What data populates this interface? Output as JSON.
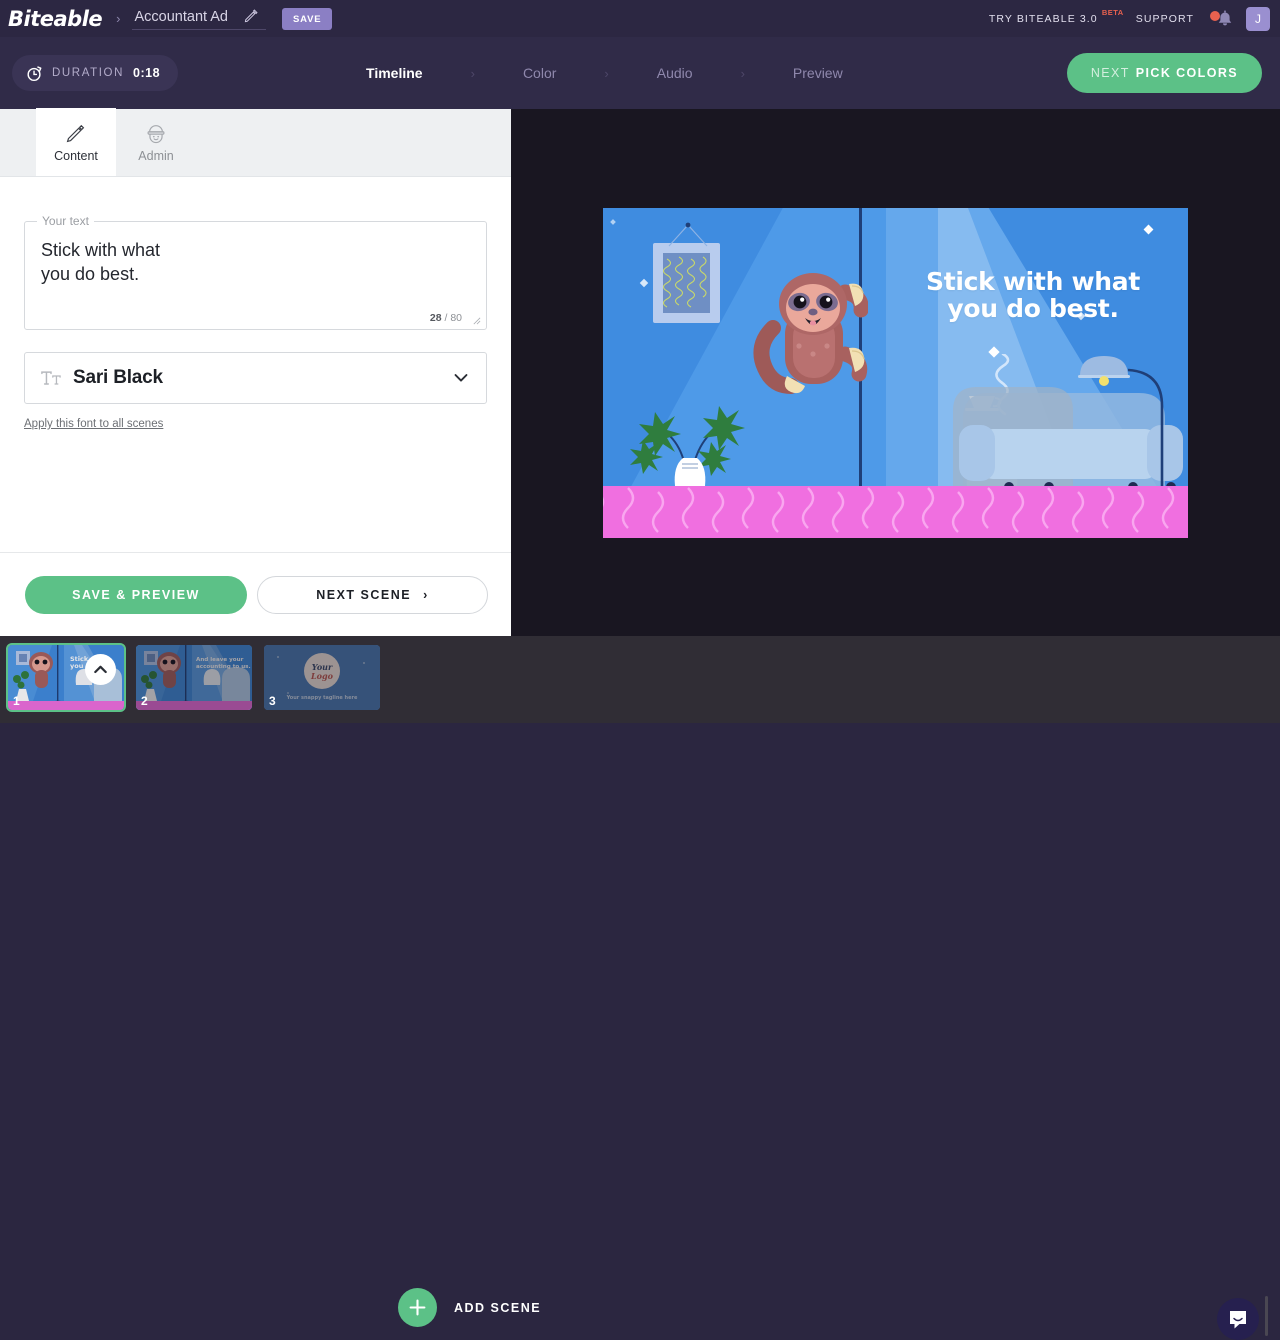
{
  "topbar": {
    "brand": "Biteable",
    "separator": "›",
    "project_name": "Accountant Ad",
    "save_label": "SAVE",
    "try_label": "TRY BITEABLE 3.0",
    "beta_label": "BETA",
    "support_label": "SUPPORT",
    "avatar_initial": "J",
    "icons": {
      "pencil": "pencil-icon",
      "bell": "bell-icon",
      "notification_dot": "notification-dot"
    },
    "colors": {
      "bar_bg": "#2c2742",
      "save_btn": "#8b7fc4",
      "beta_accent": "#e8614f",
      "avatar_bg": "#9a8fd0"
    }
  },
  "stepbar": {
    "duration_label": "DURATION",
    "duration_value": "0:18",
    "steps": [
      {
        "label": "Timeline",
        "active": true
      },
      {
        "label": "Color",
        "active": false
      },
      {
        "label": "Audio",
        "active": false
      },
      {
        "label": "Preview",
        "active": false
      }
    ],
    "step_arrow": "›",
    "next_prefix": "NEXT",
    "next_main": "PICK COLORS",
    "colors": {
      "bar_bg": "#302b48",
      "next_btn": "#5cc187",
      "pill_bg": "#3a3455"
    }
  },
  "panel": {
    "tabs": [
      {
        "label": "Content",
        "icon": "pencil-icon",
        "active": true
      },
      {
        "label": "Admin",
        "icon": "police-cap-icon",
        "active": false
      }
    ],
    "text_field": {
      "legend": "Your text",
      "value": "Stick with what\nyou do best.",
      "placeholder": "Your text",
      "char_used": "28",
      "char_sep": " / ",
      "char_max": "80"
    },
    "font_select": {
      "icon": "text-format-icon",
      "value": "Sari Black",
      "chevron": "chevron-down-icon"
    },
    "apply_link": "Apply this font to all scenes",
    "footer": {
      "save_preview_label": "SAVE & PREVIEW",
      "next_scene_label": "NEXT SCENE",
      "next_scene_arrow": "›"
    }
  },
  "stage": {
    "scene": {
      "headline": "Stick with what\nyou do best.",
      "colors": {
        "bg_blue": "#3f8ce0",
        "beam_left": "#4e9ae8",
        "beam_right": "#65a8ec",
        "floor_pink": "#f06fe0",
        "sloth_body": "#a8615f",
        "sloth_face": "#e8a79a"
      }
    },
    "bg_color": "#191621"
  },
  "bottombar": {
    "scenes": [
      {
        "number": "1",
        "selected": true,
        "caption": "Stick with what you do best.",
        "type": "sloth-scene"
      },
      {
        "number": "2",
        "selected": false,
        "caption": "And leave your accounting to us.",
        "type": "sloth-scene"
      },
      {
        "number": "3",
        "selected": false,
        "caption": "Your Logo",
        "tagline": "Your snappy tagline here",
        "type": "logo-scene"
      }
    ],
    "collapse_icon": "chevron-up-icon",
    "add_scene_label": "ADD SCENE",
    "add_icon": "plus-icon",
    "intercom_icon": "chat-bubble-icon",
    "colors": {
      "bar_bg": "#302d35",
      "add_btn": "#5cc187",
      "intercom_bg": "#26204f"
    }
  }
}
